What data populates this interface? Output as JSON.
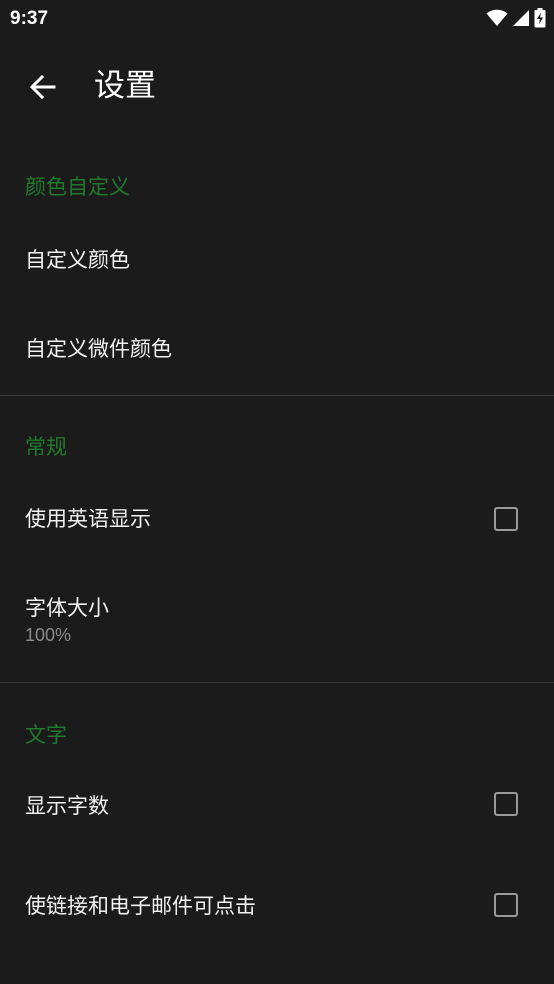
{
  "status_bar": {
    "time": "9:37",
    "icons": [
      "wifi-icon",
      "signal-icon",
      "battery-charging-icon"
    ]
  },
  "toolbar": {
    "back_icon": "arrow-back-icon",
    "title": "设置"
  },
  "colors": {
    "background": "#1b1b1b",
    "accent": "#1f7a2b",
    "divider": "#3a3a3a",
    "summary_text": "#8c8c8c",
    "checkbox_border": "#9a9a9a"
  },
  "sections": {
    "color": {
      "header": "颜色自定义",
      "items": [
        {
          "title": "自定义颜色"
        },
        {
          "title": "自定义微件颜色"
        }
      ]
    },
    "general": {
      "header": "常规",
      "items": [
        {
          "title": "使用英语显示",
          "checked": false
        },
        {
          "title": "字体大小",
          "summary": "100%"
        }
      ]
    },
    "text": {
      "header": "文字",
      "items": [
        {
          "title": "显示字数",
          "checked": false
        },
        {
          "title": "使链接和电子邮件可点击",
          "checked": false
        }
      ]
    }
  }
}
